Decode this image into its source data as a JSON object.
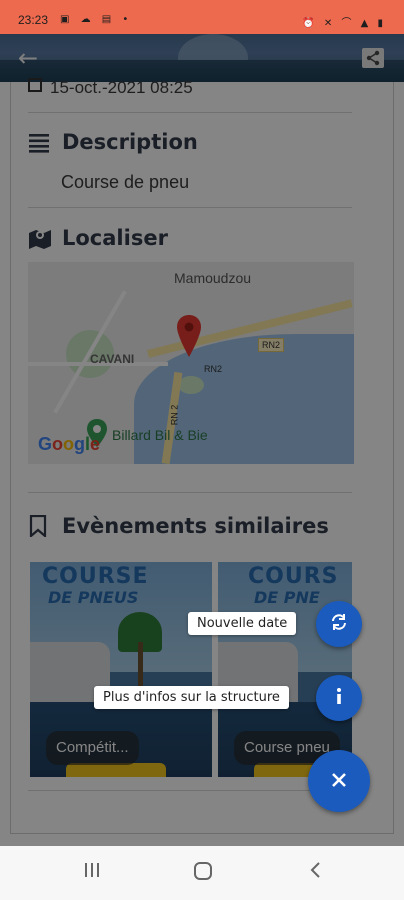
{
  "status_bar": {
    "time": "23:23",
    "left_icons": "▣ ☁ ▤ •",
    "right_icons": "⏰ ✕ ⌒ ▲ ▮"
  },
  "app_bar": {
    "back_icon": "arrow-left-icon",
    "share_icon": "share-icon"
  },
  "details": {
    "date_time": "15-oct.-2021 08:25"
  },
  "description": {
    "title": "Description",
    "text": "Course de pneu"
  },
  "location": {
    "title": "Localiser",
    "map_labels": {
      "city": "Mamoudzou",
      "district": "CAVANI",
      "road_a": "RN2",
      "road_b": "RN2",
      "road_c": "RN 2",
      "poi": "Billard Bil & Bie",
      "logo": "Google"
    }
  },
  "similar": {
    "title": "Evènements similaires",
    "cards": [
      {
        "headline": "COURSE",
        "sub": "DE PNEUS",
        "chip": "Compétit..."
      },
      {
        "headline": "COURS",
        "sub": "DE PNE",
        "chip": "Course pneu"
      }
    ]
  },
  "fab_menu": {
    "new_date_label": "Nouvelle date",
    "more_info_label": "Plus d'infos sur la structure",
    "close_icon": "close-icon"
  },
  "colors": {
    "status_bar": "#ee6a4f",
    "fab": "#1b5bbd",
    "scrim": "rgba(0,0,0,0.48)"
  }
}
